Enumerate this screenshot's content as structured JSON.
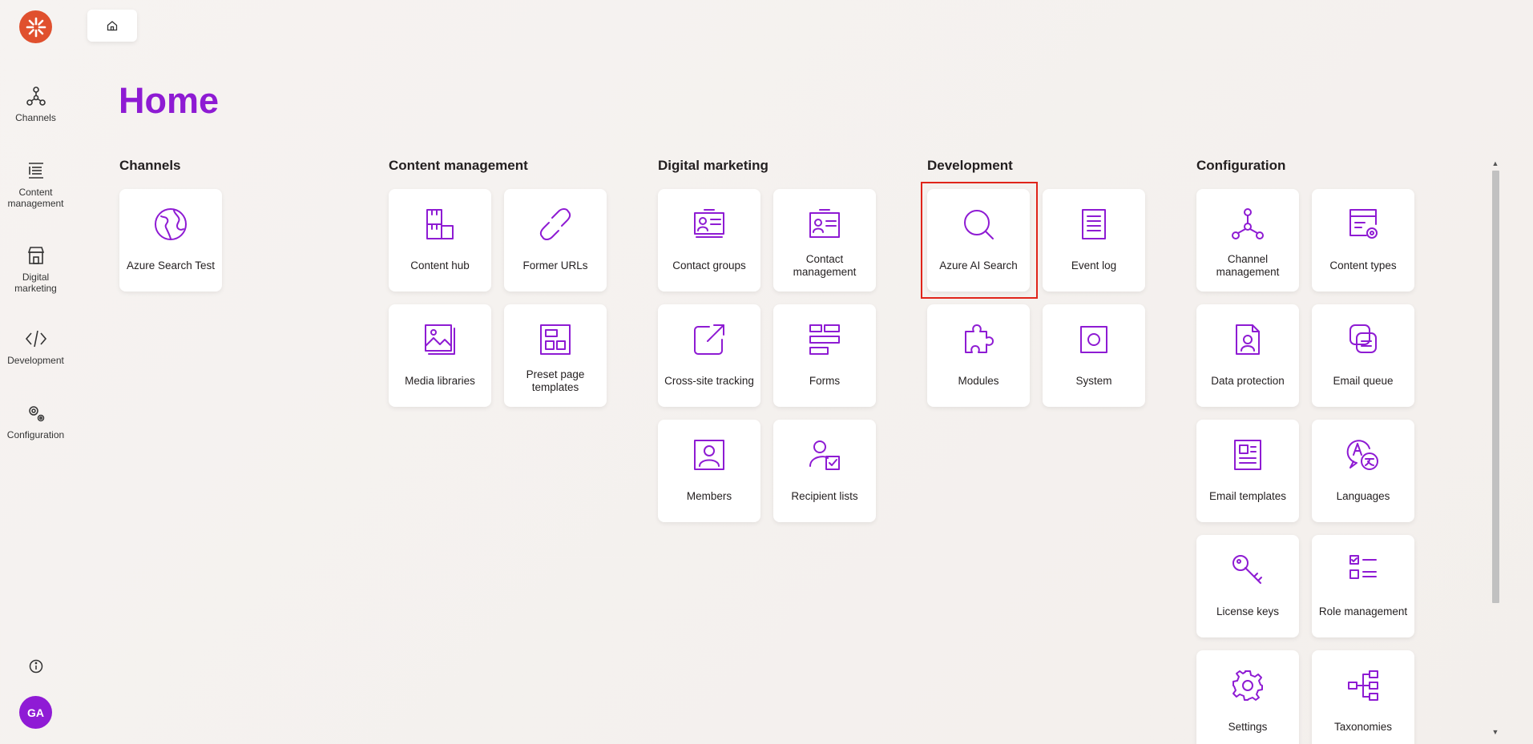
{
  "rail": {
    "items": [
      {
        "label": "Channels",
        "icon": "channels-icon"
      },
      {
        "label": "Content\nmanagement",
        "icon": "content-management-icon"
      },
      {
        "label": "Digital\nmarketing",
        "icon": "digital-marketing-icon"
      },
      {
        "label": "Development",
        "icon": "development-icon"
      },
      {
        "label": "Configuration",
        "icon": "configuration-icon"
      }
    ],
    "avatar_initials": "GA"
  },
  "page": {
    "title": "Home"
  },
  "groups": [
    {
      "title": "Channels",
      "tiles": [
        {
          "label": "Azure Search Test",
          "icon": "globe-icon"
        }
      ]
    },
    {
      "title": "Content management",
      "tiles": [
        {
          "label": "Content hub",
          "icon": "boxes-icon"
        },
        {
          "label": "Former URLs",
          "icon": "link-icon"
        },
        {
          "label": "Media libraries",
          "icon": "image-icon"
        },
        {
          "label": "Preset page templates",
          "icon": "layout-icon"
        }
      ]
    },
    {
      "title": "Digital marketing",
      "tiles": [
        {
          "label": "Contact groups",
          "icon": "contact-cards-icon"
        },
        {
          "label": "Contact management",
          "icon": "contact-card-icon"
        },
        {
          "label": "Cross-site tracking",
          "icon": "external-link-icon"
        },
        {
          "label": "Forms",
          "icon": "form-icon"
        },
        {
          "label": "Members",
          "icon": "member-icon"
        },
        {
          "label": "Recipient lists",
          "icon": "user-check-icon"
        }
      ]
    },
    {
      "title": "Development",
      "tiles": [
        {
          "label": "Azure AI Search",
          "icon": "search-icon"
        },
        {
          "label": "Event log",
          "icon": "document-icon"
        },
        {
          "label": "Modules",
          "icon": "puzzle-icon"
        },
        {
          "label": "System",
          "icon": "system-icon"
        }
      ]
    },
    {
      "title": "Configuration",
      "tiles": [
        {
          "label": "Channel management",
          "icon": "channels-icon"
        },
        {
          "label": "Content types",
          "icon": "content-types-icon"
        },
        {
          "label": "Data protection",
          "icon": "data-protection-icon"
        },
        {
          "label": "Email queue",
          "icon": "email-queue-icon"
        },
        {
          "label": "Email templates",
          "icon": "email-template-icon"
        },
        {
          "label": "Languages",
          "icon": "languages-icon"
        },
        {
          "label": "License keys",
          "icon": "key-icon"
        },
        {
          "label": "Role management",
          "icon": "checklist-icon"
        },
        {
          "label": "Settings",
          "icon": "gear-icon"
        },
        {
          "label": "Taxonomies",
          "icon": "taxonomy-icon"
        }
      ]
    }
  ],
  "colors": {
    "accent": "#8e1bd3",
    "logo": "#e0502e",
    "highlight": "#e0241a"
  }
}
